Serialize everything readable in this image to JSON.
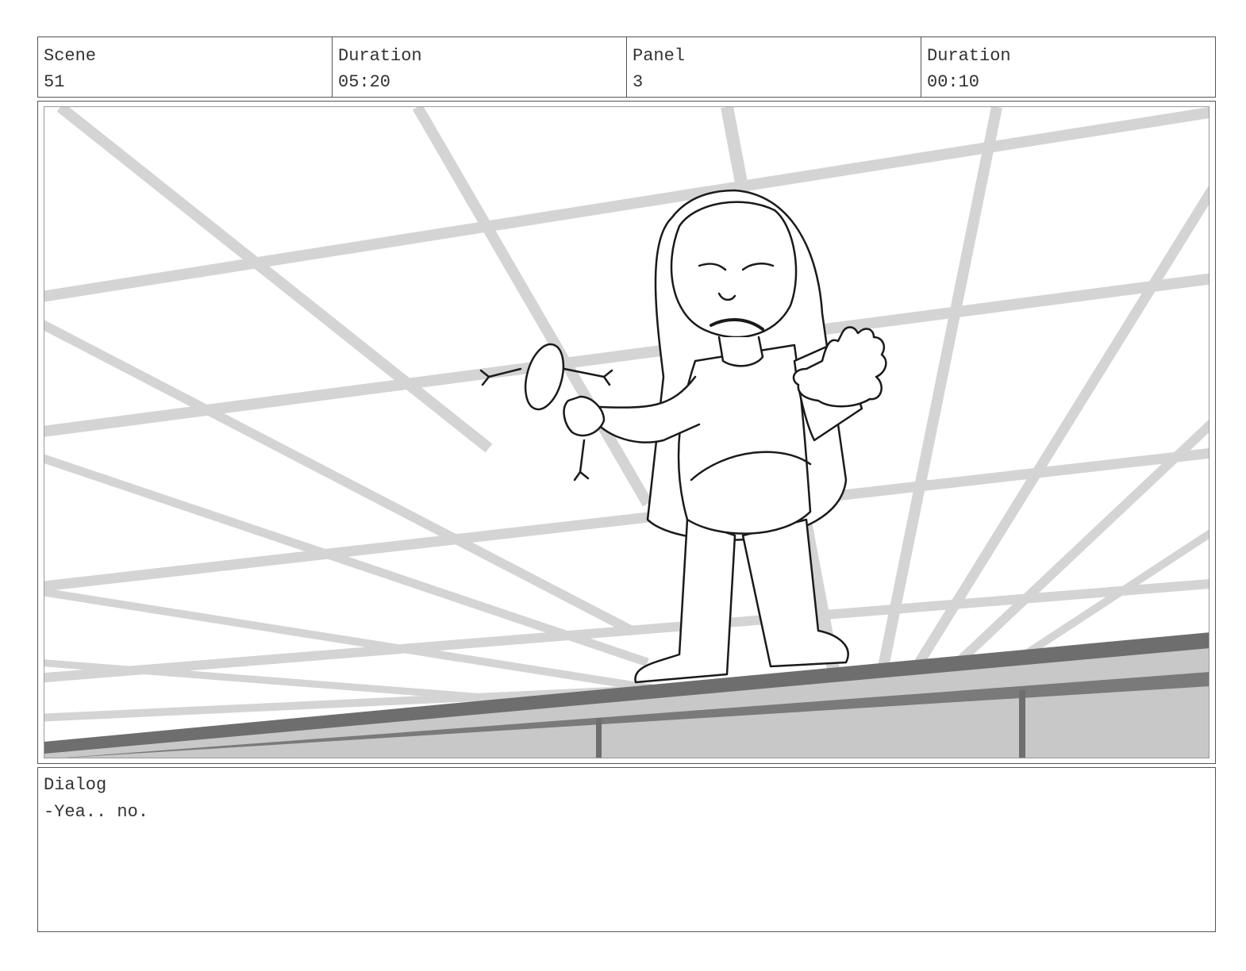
{
  "header": {
    "scene": {
      "label": "Scene",
      "value": "51"
    },
    "scene_duration": {
      "label": "Duration",
      "value": "05:20"
    },
    "panel": {
      "label": "Panel",
      "value": "3"
    },
    "panel_duration": {
      "label": "Duration",
      "value": "00:10"
    }
  },
  "drawing": {
    "description_icon": "storyboard-sketch",
    "colors": {
      "grid": "#d2d2d2",
      "ledge_dark": "#6e6e6e",
      "ledge_fill": "#c8c8c8",
      "line": "#1a1a1a"
    }
  },
  "dialog": {
    "label": "Dialog",
    "text": "-Yea.. no."
  }
}
